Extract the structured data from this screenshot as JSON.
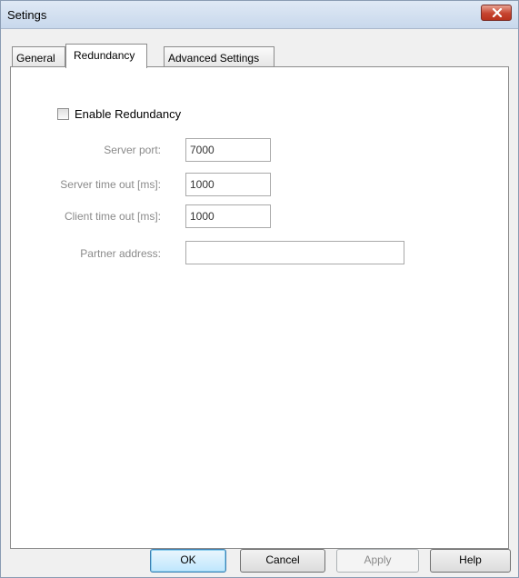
{
  "window": {
    "title": "Setings"
  },
  "tabs": [
    {
      "label": "General",
      "active": false
    },
    {
      "label": "Redundancy",
      "active": true
    },
    {
      "label": "Advanced Settings",
      "active": false
    }
  ],
  "redundancy": {
    "enable_label": "Enable Redundancy",
    "enable_checked": false,
    "fields": [
      {
        "label": "Server port:",
        "value": "7000"
      },
      {
        "label": "Server time out [ms]:",
        "value": "1000"
      },
      {
        "label": "Client time out [ms]:",
        "value": "1000"
      },
      {
        "label": "Partner address:",
        "value": ""
      }
    ]
  },
  "buttons": {
    "ok": "OK",
    "cancel": "Cancel",
    "apply": "Apply",
    "help": "Help"
  },
  "icons": {
    "close": "close-icon"
  }
}
